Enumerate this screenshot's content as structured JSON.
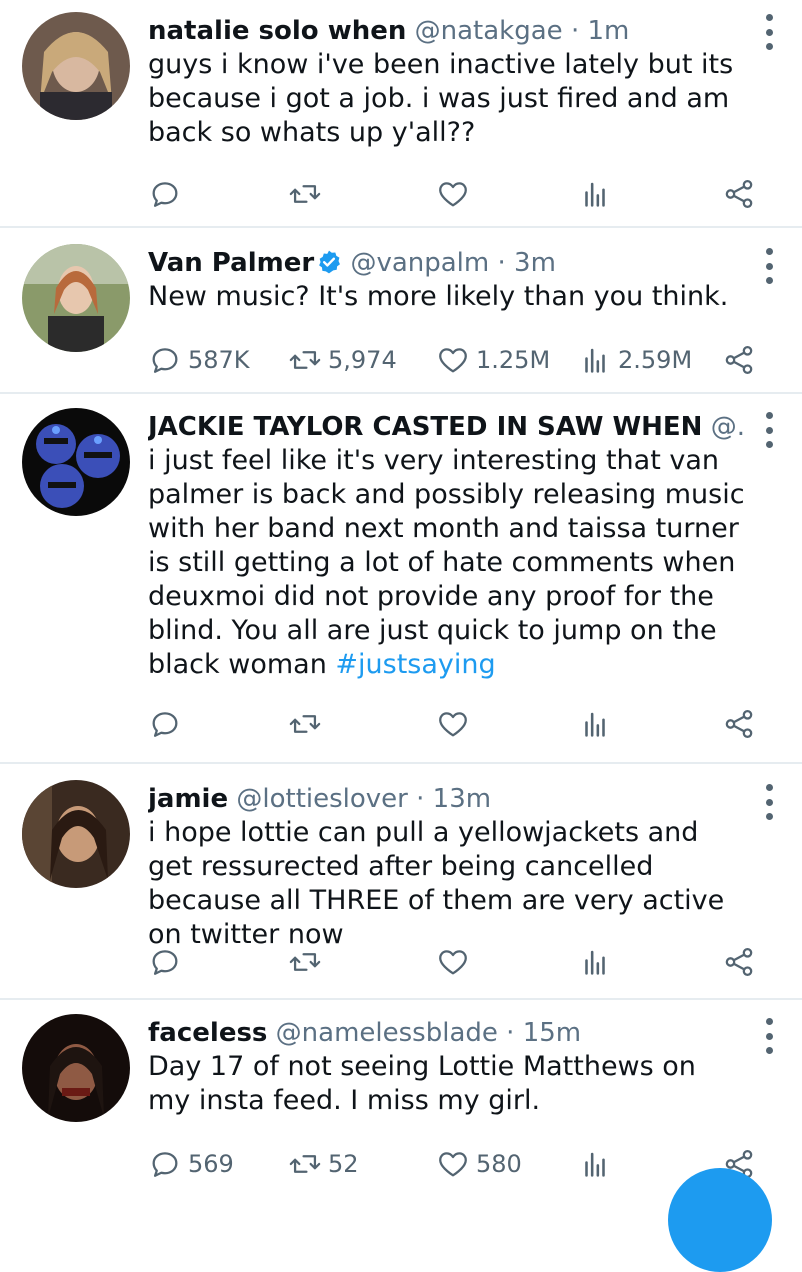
{
  "tweets": [
    {
      "name": "natalie solo when",
      "handle": "@natakgae",
      "dot": "·",
      "time": "1m",
      "verified": false,
      "text": "guys i know i've been inactive lately but its because i got a job. i was just fired and am back so whats up y'all??",
      "hashtag": "",
      "stats": {
        "reply": "",
        "retweet": "",
        "like": "",
        "views": ""
      }
    },
    {
      "name": "Van Palmer",
      "handle": "@vanpalm",
      "dot": "·",
      "time": "3m",
      "verified": true,
      "text": "New music? It's more likely than you think.",
      "hashtag": "",
      "stats": {
        "reply": "587K",
        "retweet": "5,974",
        "like": "1.25M",
        "views": "2.59M"
      }
    },
    {
      "name": "JACKIE TAYLOR CASTED IN SAW WHEN",
      "handle": "@...",
      "dot": "",
      "time": "",
      "verified": false,
      "text": "i just feel like it's very interesting that van palmer is back and possibly releasing music with her band next month and taissa turner is still getting a lot of hate comments when deuxmoi did not provide any proof for the blind. You all are just quick to jump on the black woman ",
      "hashtag": "#justsaying",
      "stats": {
        "reply": "",
        "retweet": "",
        "like": "",
        "views": ""
      }
    },
    {
      "name": "jamie",
      "handle": "@lottieslover",
      "dot": "·",
      "time": "13m",
      "verified": false,
      "text": "i hope lottie can pull a yellowjackets and get ressurected after being cancelled because all THREE of them are very active on twitter now",
      "hashtag": "",
      "stats": {
        "reply": "",
        "retweet": "",
        "like": "",
        "views": ""
      }
    },
    {
      "name": "faceless",
      "handle": "@namelessblade",
      "dot": "·",
      "time": "15m",
      "verified": false,
      "text": "Day 17 of not seeing Lottie Matthews on my insta feed. I miss my girl.",
      "hashtag": "",
      "stats": {
        "reply": "569",
        "retweet": "52",
        "like": "580",
        "views": ""
      }
    }
  ],
  "icons": {
    "reply": "reply-icon",
    "retweet": "retweet-icon",
    "like": "heart-icon",
    "views": "views-icon",
    "share": "share-icon",
    "more": "more-options-icon",
    "verified": "verified-badge-icon"
  },
  "colors": {
    "accent": "#1d9bf0",
    "muted": "#536471",
    "divider": "#e6ecf0"
  }
}
